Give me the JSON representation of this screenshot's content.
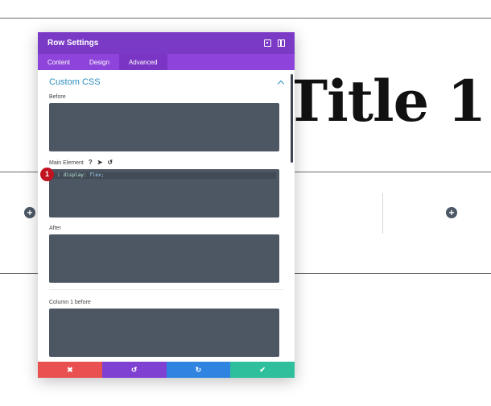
{
  "background": {
    "title": "Title 1"
  },
  "modal": {
    "title": "Row Settings",
    "tabs": [
      {
        "label": "Content"
      },
      {
        "label": "Design"
      },
      {
        "label": "Advanced"
      }
    ],
    "active_tab": "Advanced",
    "section_title": "Custom CSS",
    "fields": {
      "before": {
        "label": "Before"
      },
      "main": {
        "label": "Main Element",
        "code_line_number": "1",
        "code_property": "display:",
        "code_value": "flex;"
      },
      "after": {
        "label": "After"
      },
      "col1_before": {
        "label": "Column 1 before"
      }
    },
    "help_icon": "?",
    "badge": "1"
  },
  "footer": {
    "cancel": "✖",
    "undo": "↺",
    "redo": "↻",
    "save": "✔"
  },
  "colors": {
    "header": "#7b3ac6",
    "tabs": "#8e44da",
    "cancel": "#e95151",
    "undo": "#7f41d1",
    "redo": "#2e84e0",
    "save": "#2fbf9c",
    "section_title": "#2d8fbf",
    "code_bg": "#4d5663",
    "badge": "#c1121f"
  },
  "icons": {
    "header": [
      "expand-icon",
      "split-view-icon"
    ],
    "field_tools": [
      "help-icon",
      "pointer-icon",
      "reset-icon"
    ],
    "footer": [
      "close-icon",
      "undo-icon",
      "redo-icon",
      "check-icon"
    ],
    "page": [
      "add-module-icon"
    ]
  }
}
